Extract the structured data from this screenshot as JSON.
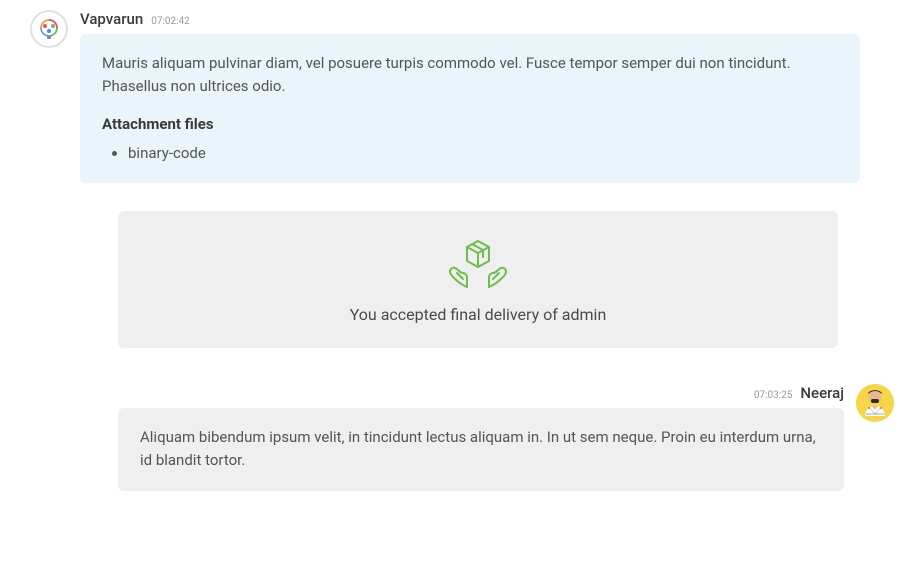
{
  "messages": {
    "first": {
      "username": "Vapvarun",
      "timestamp": "07:02:42",
      "body": "Mauris aliquam pulvinar diam, vel posuere turpis commodo vel. Fusce tempor semper dui non tincidunt. Phasellus non ultrices odio.",
      "attachments_heading": "Attachment files",
      "attachments": [
        "binary-code"
      ]
    },
    "system": {
      "text": "You accepted final delivery of admin"
    },
    "second": {
      "username": "Neeraj",
      "timestamp": "07:03:25",
      "body": "Aliquam bibendum ipsum velit, in tincidunt lectus aliquam in. In ut sem neque. Proin eu interdum urna, id blandit tortor."
    }
  }
}
